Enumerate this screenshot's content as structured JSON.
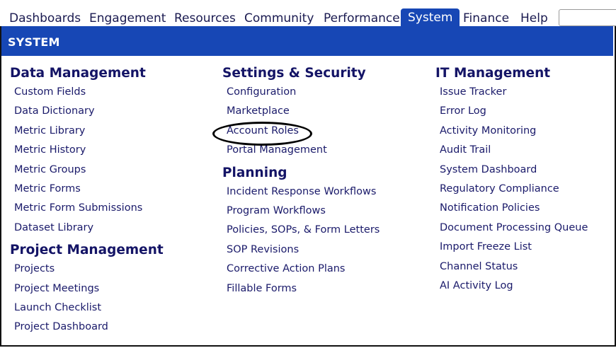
{
  "nav": {
    "tabs": [
      {
        "label": "Dashboards"
      },
      {
        "label": "Engagement"
      },
      {
        "label": "Resources"
      },
      {
        "label": "Community"
      },
      {
        "label": "Performance"
      },
      {
        "label": "System",
        "active": true
      },
      {
        "label": "Finance"
      },
      {
        "label": "Help"
      }
    ],
    "search_placeholder": ""
  },
  "section_title": "SYSTEM",
  "columns": [
    {
      "groups": [
        {
          "title": "Data Management",
          "items": [
            "Custom Fields",
            "Data Dictionary",
            "Metric Library",
            "Metric History",
            "Metric Groups",
            "Metric Forms",
            "Metric Form Submissions",
            "Dataset Library"
          ]
        },
        {
          "title": "Project Management",
          "items": [
            "Projects",
            "Project Meetings",
            "Launch Checklist",
            "Project Dashboard"
          ]
        }
      ]
    },
    {
      "groups": [
        {
          "title": "Settings & Security",
          "items": [
            "Configuration",
            "Marketplace",
            "Account Roles",
            "Portal Management"
          ]
        },
        {
          "title": "Planning",
          "items": [
            "Incident Response Workflows",
            "Program Workflows",
            "Policies, SOPs, & Form Letters",
            "SOP Revisions",
            "Corrective Action Plans",
            "Fillable Forms"
          ]
        }
      ]
    },
    {
      "groups": [
        {
          "title": "IT Management",
          "items": [
            "Issue Tracker",
            "Error Log",
            "Activity Monitoring",
            "Audit Trail",
            "System Dashboard",
            "Regulatory Compliance",
            "Notification Policies",
            "Document Processing Queue",
            "Import Freeze List",
            "Channel Status",
            "AI Activity Log"
          ]
        }
      ]
    }
  ],
  "highlight": {
    "item": "Account Roles",
    "shape": "ellipse",
    "color": "#000000"
  },
  "colors": {
    "brand": "#1747b5",
    "heading": "#141466",
    "link": "#1a1a6a"
  }
}
